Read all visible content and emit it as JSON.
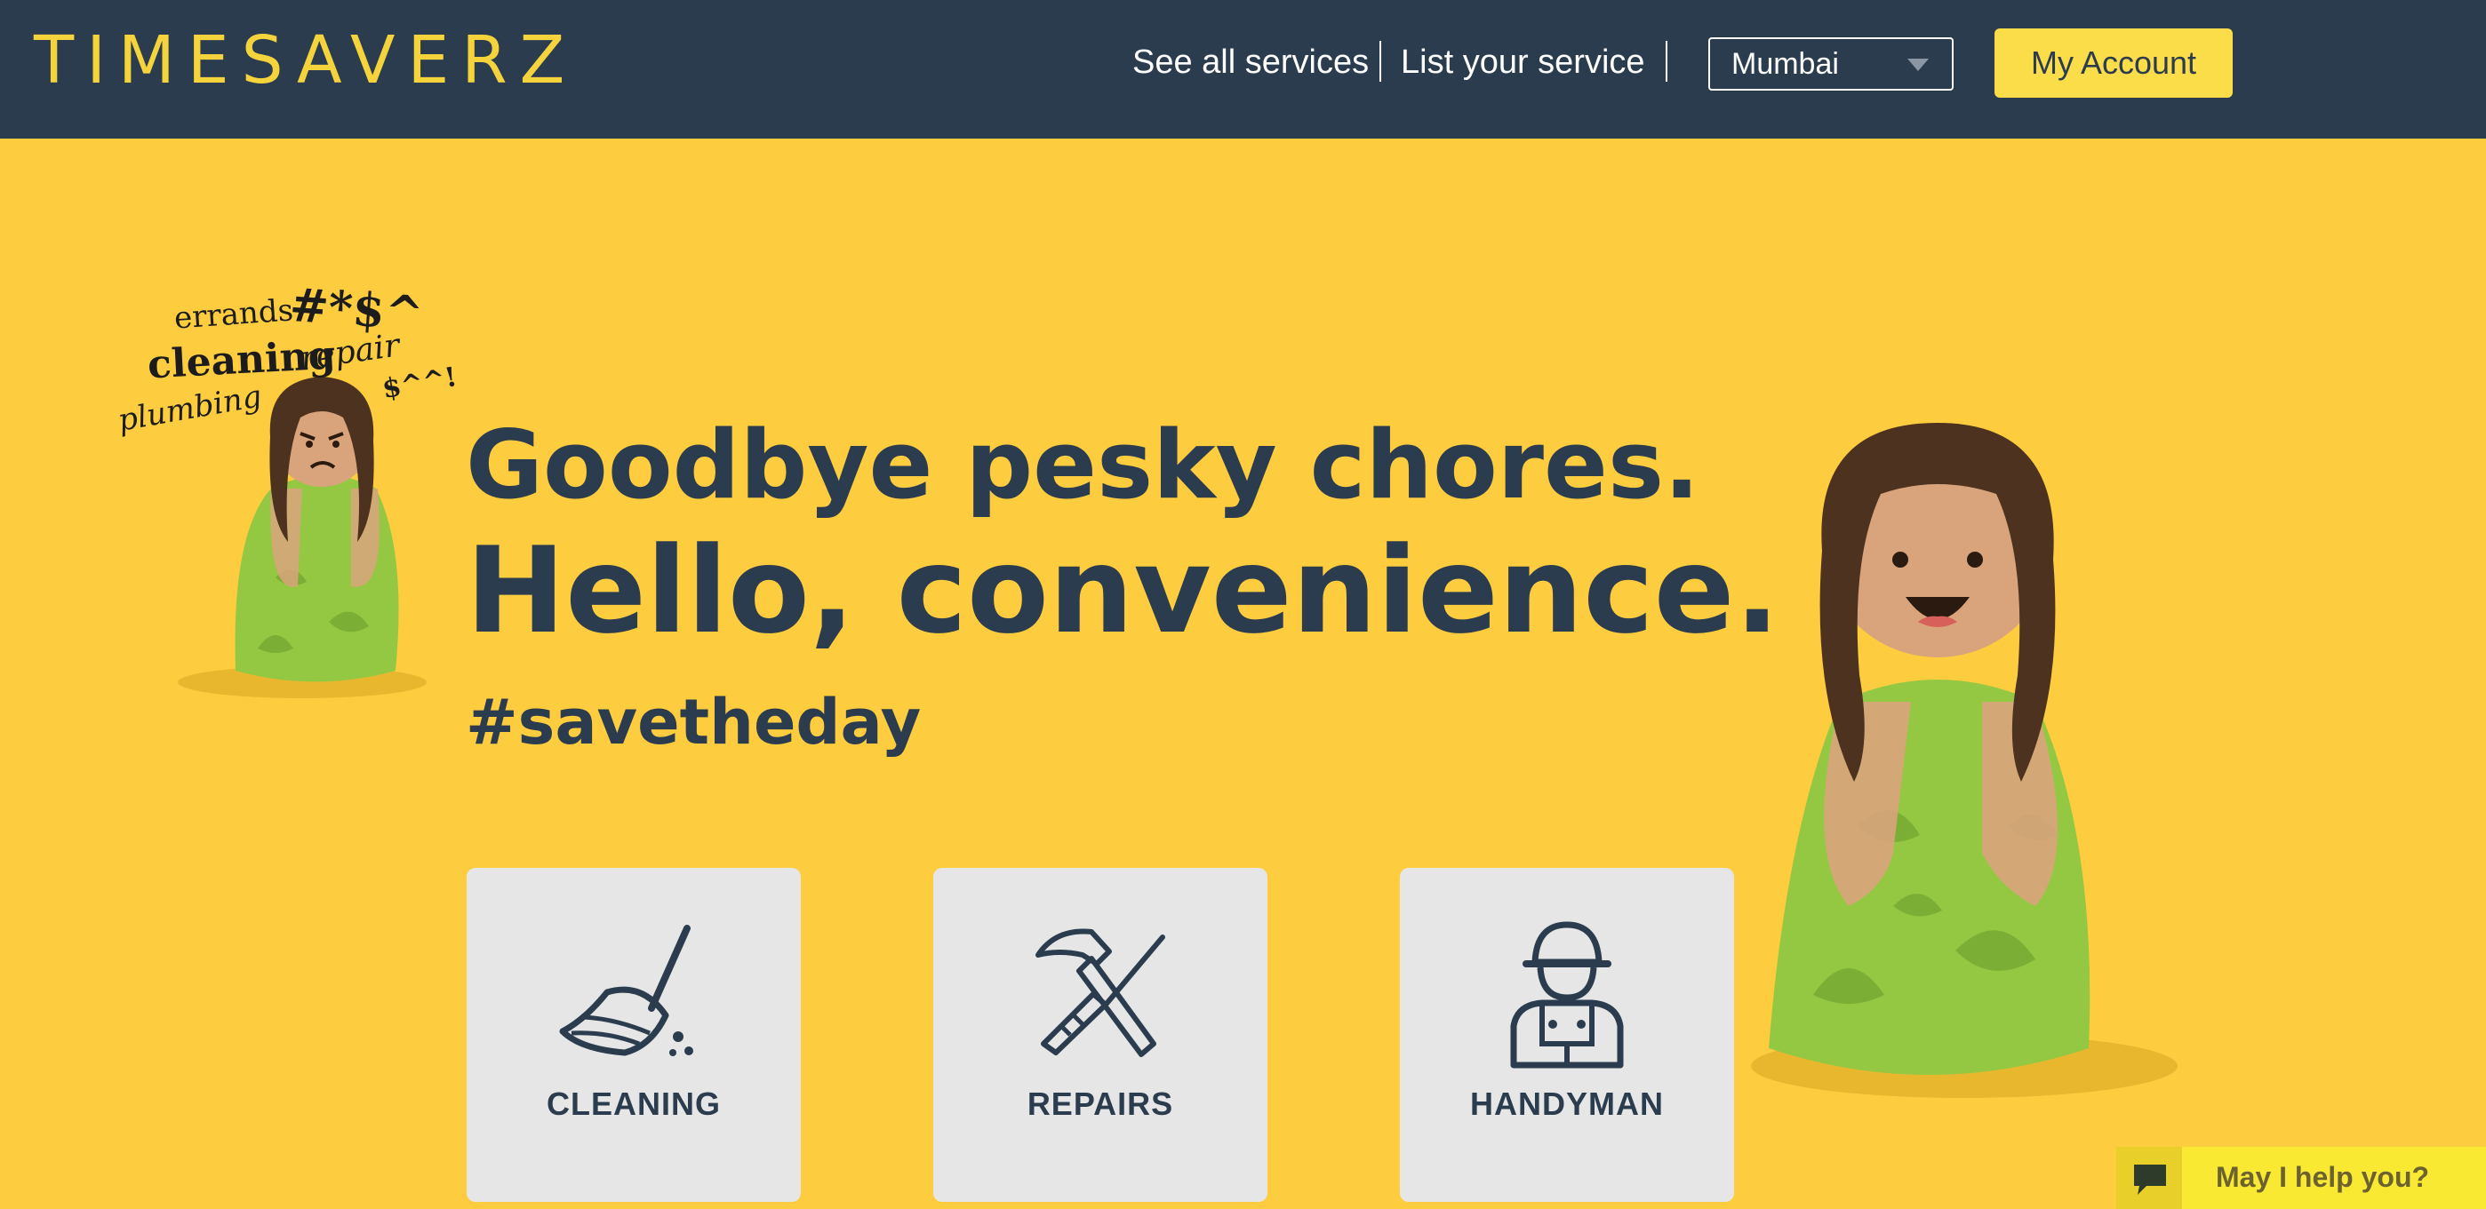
{
  "header": {
    "logo": "TIMESAVERZ",
    "nav": {
      "see_all": "See all services",
      "list_service": "List your service"
    },
    "city": {
      "selected": "Mumbai"
    },
    "account_label": "My Account"
  },
  "hero": {
    "line1": "Goodbye pesky chores.",
    "line2": "Hello, convenience.",
    "hashtag": "#savetheday",
    "scribbles": {
      "errands": "errands",
      "symbols": "#*$^",
      "cleaning": "cleaning",
      "repair": "repair",
      "plumbing": "plumbing",
      "money": "$^^!"
    }
  },
  "services": [
    {
      "label": "CLEANING",
      "icon": "broom-icon"
    },
    {
      "label": "REPAIRS",
      "icon": "hammer-screwdriver-icon"
    },
    {
      "label": "HANDYMAN",
      "icon": "worker-icon"
    }
  ],
  "chat": {
    "label": "May I help you?",
    "icon": "chat-bubble-icon"
  },
  "colors": {
    "header_bg": "#2b3c4e",
    "page_bg": "#fecc3f",
    "accent_yellow": "#fbdc49",
    "text_dark": "#2b3c4e",
    "card_bg": "#e6e6e6",
    "figure_green": "#8cc63f"
  }
}
